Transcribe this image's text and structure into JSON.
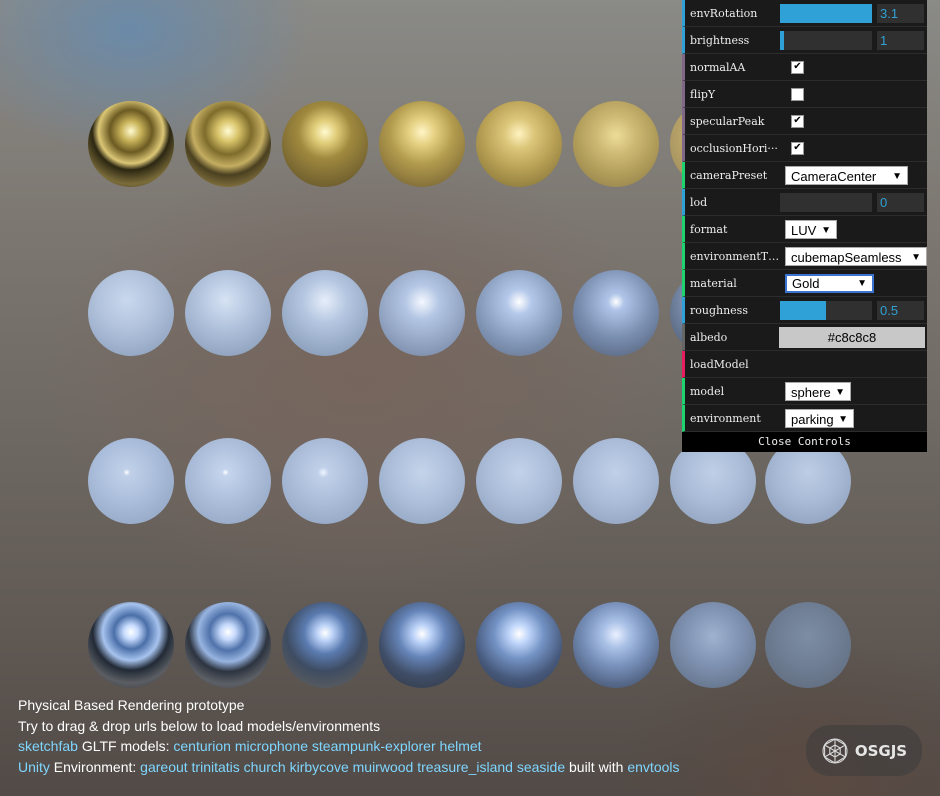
{
  "sphere_rows": [
    {
      "material": "gold",
      "count": 7
    },
    {
      "material": "blue-diffuse",
      "count": 7
    },
    {
      "material": "blue-matte",
      "count": 8
    },
    {
      "material": "chrome",
      "count": 8
    }
  ],
  "controls": {
    "envRotation": {
      "label": "envRotation",
      "value": "3.1",
      "fill": 1.0
    },
    "brightness": {
      "label": "brightness",
      "value": "1",
      "fill": 0.04
    },
    "normalAA": {
      "label": "normalAA",
      "checked": true
    },
    "flipY": {
      "label": "flipY",
      "checked": false
    },
    "specularPeak": {
      "label": "specularPeak",
      "checked": true
    },
    "occlusionHorizon": {
      "label": "occlusionHori···",
      "checked": true
    },
    "cameraPreset": {
      "label": "cameraPreset",
      "value": "CameraCenter"
    },
    "lod": {
      "label": "lod",
      "value": "0",
      "fill": 0
    },
    "format": {
      "label": "format",
      "value": "LUV"
    },
    "environmentType": {
      "label": "environmentType",
      "value": "cubemapSeamless"
    },
    "material": {
      "label": "material",
      "value": "Gold"
    },
    "roughness": {
      "label": "roughness",
      "value": "0.5",
      "fill": 0.5
    },
    "albedo": {
      "label": "albedo",
      "value": "#c8c8c8"
    },
    "loadModel": {
      "label": "loadModel"
    },
    "model": {
      "label": "model",
      "value": "sphere"
    },
    "environment": {
      "label": "environment",
      "value": "parking"
    },
    "close_label": "Close Controls"
  },
  "footer": {
    "line1": "Physical Based Rendering prototype",
    "line2": "Try to drag & drop urls below to load models/environments",
    "sketchfab": "sketchfab",
    "gltf_text": "GLTF models:",
    "models": [
      "centurion",
      "microphone",
      "steampunk-explorer",
      "helmet"
    ],
    "unity": "Unity",
    "env_text": "Environment:",
    "environments": [
      "gareout",
      "trinitatis",
      "church",
      "kirbycove",
      "muirwood",
      "treasure_island",
      "seaside"
    ],
    "built_with": "built with",
    "envtools": "envtools"
  },
  "logo": {
    "text": "OSGJS"
  },
  "colors": {
    "accent": "#2fa1d6",
    "link": "#7ed6ff",
    "panel_bg": "#1a1a1a"
  }
}
